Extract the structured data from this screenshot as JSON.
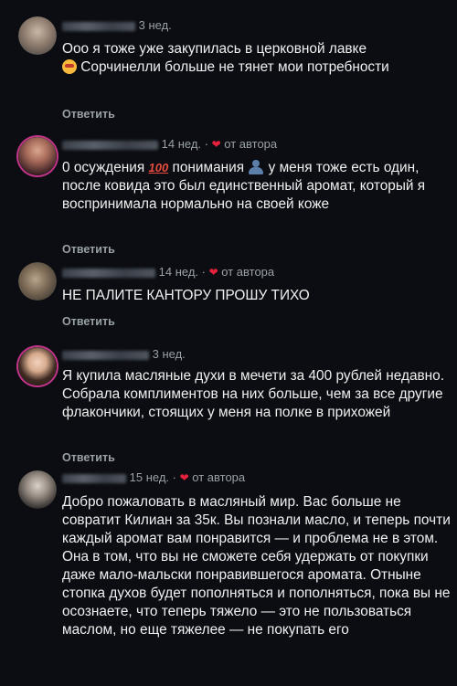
{
  "reply_label": "Ответить",
  "author_label": "от автора",
  "comments": [
    {
      "time": "3 нед.",
      "text": "Ооо я тоже уже закупилась в церковной лавке",
      "text2": "Сорчинелли больше не тянет мои потребности",
      "by_author": false
    },
    {
      "time": "14 нед.",
      "text_a": "0 осуждения",
      "text_b": "понимания",
      "text_c": "у меня тоже есть один, после ковида это был единственный аромат, который я воспринимала нормально на своей коже",
      "by_author": true
    },
    {
      "time": "14 нед.",
      "text": "НЕ ПАЛИТЕ КАНТОРУ ПРОШУ ТИХО",
      "by_author": true
    },
    {
      "time": "3 нед.",
      "text": "Я купила масляные духи в мечети за 400 рублей недавно. Собрала комплиментов на них больше, чем за все другие флакончики, стоящих у меня на полке в прихожей",
      "by_author": false
    },
    {
      "time": "15 нед.",
      "text": "Добро пожаловать в масляный мир. Вас больше не совратит Килиан за 35к. Вы познали масло, и теперь почти каждый аромат вам понравится — и проблема не в этом. Она в том, что вы не сможете себя удержать от покупки даже мало-мальски понравившегося аромата. Отныне стопка духов будет пополняться и пополняться, пока вы не осознаете, что теперь тяжело — это не пользоваться маслом, но еще тяжелее — не покупать его",
      "by_author": true
    }
  ],
  "colors": {
    "background": "#0b0d12",
    "heart": "#e8213c",
    "muted": "#9aa0a8"
  }
}
